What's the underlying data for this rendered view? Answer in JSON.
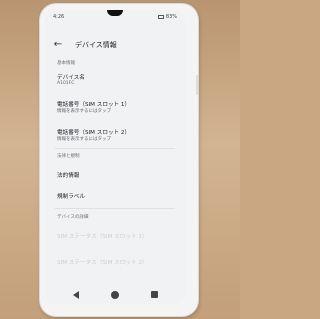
{
  "status": {
    "time": "4:26",
    "battery": "83%"
  },
  "appbar": {
    "back_icon": "arrow-back-icon",
    "title": "デバイス情報"
  },
  "sections": {
    "basic": "基本情報",
    "legal": "法律と規制",
    "details": "デバイスの詳細"
  },
  "items": {
    "device_name": {
      "title": "デバイス名",
      "value": "A101FC"
    },
    "phone1": {
      "title": "電話番号（SIM スロット 1）",
      "sub": "情報を表示するにはタップ"
    },
    "phone2": {
      "title": "電話番号（SIM スロット 2）",
      "sub": "情報を表示するにはタップ"
    },
    "legal_info": {
      "title": "法的情報"
    },
    "reg_labels": {
      "title": "規制ラベル"
    },
    "sim_status1": {
      "title": "SIM ステータス（SIM スロット 1）"
    },
    "sim_status2": {
      "title": "SIM ステータス（SIM スロット 2）"
    }
  },
  "navbar": {
    "back": "nav-back-icon",
    "home": "nav-home-icon",
    "recents": "nav-recents-icon"
  }
}
